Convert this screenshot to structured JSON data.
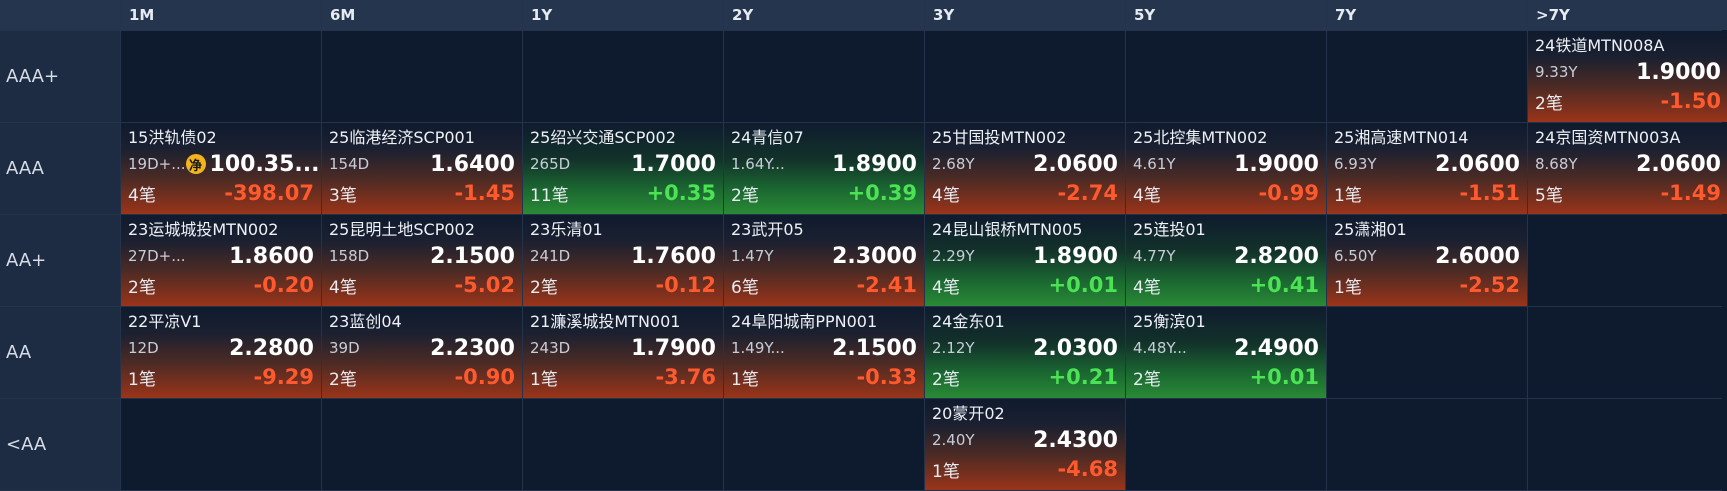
{
  "columns": [
    "1M",
    "6M",
    "1Y",
    "2Y",
    "3Y",
    "5Y",
    "7Y",
    ">7Y"
  ],
  "rows": [
    "AAA+",
    "AAA",
    "AA+",
    "AA",
    "<AA"
  ],
  "colors": {
    "negative": "#ff5a2e",
    "positive": "#4be254",
    "badge": "#f2b51c"
  },
  "cells": {
    "AAA+": [
      null,
      null,
      null,
      null,
      null,
      null,
      null,
      {
        "name": "24铁道MTN008A",
        "term": "9.33Y",
        "yield": "1.9000",
        "count": "2笔",
        "change": "-1.50",
        "tone": "red"
      }
    ],
    "AAA": [
      {
        "name": "15洪轨债02",
        "term": "19D+...",
        "yield": "100.35...",
        "count": "4笔",
        "change": "-398.07",
        "tone": "red",
        "badge": "净"
      },
      {
        "name": "25临港经济SCP001",
        "term": "154D",
        "yield": "1.6400",
        "count": "3笔",
        "change": "-1.45",
        "tone": "red"
      },
      {
        "name": "25绍兴交通SCP002",
        "term": "265D",
        "yield": "1.7000",
        "count": "11笔",
        "change": "+0.35",
        "tone": "green"
      },
      {
        "name": "24青信07",
        "term": "1.64Y...",
        "yield": "1.8900",
        "count": "2笔",
        "change": "+0.39",
        "tone": "green"
      },
      {
        "name": "25甘国投MTN002",
        "term": "2.68Y",
        "yield": "2.0600",
        "count": "4笔",
        "change": "-2.74",
        "tone": "red"
      },
      {
        "name": "25北控集MTN002",
        "term": "4.61Y",
        "yield": "1.9000",
        "count": "4笔",
        "change": "-0.99",
        "tone": "red"
      },
      {
        "name": "25湘高速MTN014",
        "term": "6.93Y",
        "yield": "2.0600",
        "count": "1笔",
        "change": "-1.51",
        "tone": "red"
      },
      {
        "name": "24京国资MTN003A",
        "term": "8.68Y",
        "yield": "2.0600",
        "count": "5笔",
        "change": "-1.49",
        "tone": "red"
      }
    ],
    "AA+": [
      {
        "name": "23运城城投MTN002",
        "term": "27D+...",
        "yield": "1.8600",
        "count": "2笔",
        "change": "-0.20",
        "tone": "red"
      },
      {
        "name": "25昆明土地SCP002",
        "term": "158D",
        "yield": "2.1500",
        "count": "4笔",
        "change": "-5.02",
        "tone": "red"
      },
      {
        "name": "23乐清01",
        "term": "241D",
        "yield": "1.7600",
        "count": "2笔",
        "change": "-0.12",
        "tone": "red"
      },
      {
        "name": "23武开05",
        "term": "1.47Y",
        "yield": "2.3000",
        "count": "6笔",
        "change": "-2.41",
        "tone": "red"
      },
      {
        "name": "24昆山银桥MTN005",
        "term": "2.29Y",
        "yield": "1.8900",
        "count": "4笔",
        "change": "+0.01",
        "tone": "green"
      },
      {
        "name": "25连投01",
        "term": "4.77Y",
        "yield": "2.8200",
        "count": "4笔",
        "change": "+0.41",
        "tone": "green"
      },
      {
        "name": "25潇湘01",
        "term": "6.50Y",
        "yield": "2.6000",
        "count": "1笔",
        "change": "-2.52",
        "tone": "red"
      },
      null
    ],
    "AA": [
      {
        "name": "22平凉V1",
        "term": "12D",
        "yield": "2.2800",
        "count": "1笔",
        "change": "-9.29",
        "tone": "red"
      },
      {
        "name": "23蓝创04",
        "term": "39D",
        "yield": "2.2300",
        "count": "2笔",
        "change": "-0.90",
        "tone": "red"
      },
      {
        "name": "21濂溪城投MTN001",
        "term": "243D",
        "yield": "1.7900",
        "count": "1笔",
        "change": "-3.76",
        "tone": "red"
      },
      {
        "name": "24阜阳城南PPN001",
        "term": "1.49Y...",
        "yield": "2.1500",
        "count": "1笔",
        "change": "-0.33",
        "tone": "red"
      },
      {
        "name": "24金东01",
        "term": "2.12Y",
        "yield": "2.0300",
        "count": "2笔",
        "change": "+0.21",
        "tone": "green"
      },
      {
        "name": "25衡滨01",
        "term": "4.48Y...",
        "yield": "2.4900",
        "count": "2笔",
        "change": "+0.01",
        "tone": "green"
      },
      null,
      null
    ],
    "<AA": [
      null,
      null,
      null,
      null,
      {
        "name": "20蒙开02",
        "term": "2.40Y",
        "yield": "2.4300",
        "count": "1笔",
        "change": "-4.68",
        "tone": "red"
      },
      null,
      null,
      null
    ]
  }
}
